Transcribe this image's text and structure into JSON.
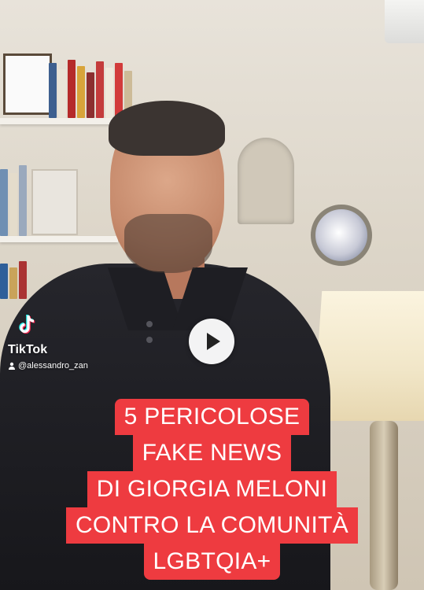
{
  "tiktok": {
    "brand": "TikTok",
    "username": "@alessandro_zan"
  },
  "overlay": {
    "play_icon": "play-icon"
  },
  "caption": {
    "lines": [
      "5 PERICOLOSE",
      "FAKE NEWS",
      "DI GIORGIA MELONI",
      "CONTRO LA COMUNITÀ",
      "LGBTQIA+"
    ],
    "background_color": "#ee3b40",
    "text_color": "#ffffff"
  },
  "colors": {
    "tiktok_cyan": "#25f4ee",
    "tiktok_red": "#fe2c55"
  }
}
